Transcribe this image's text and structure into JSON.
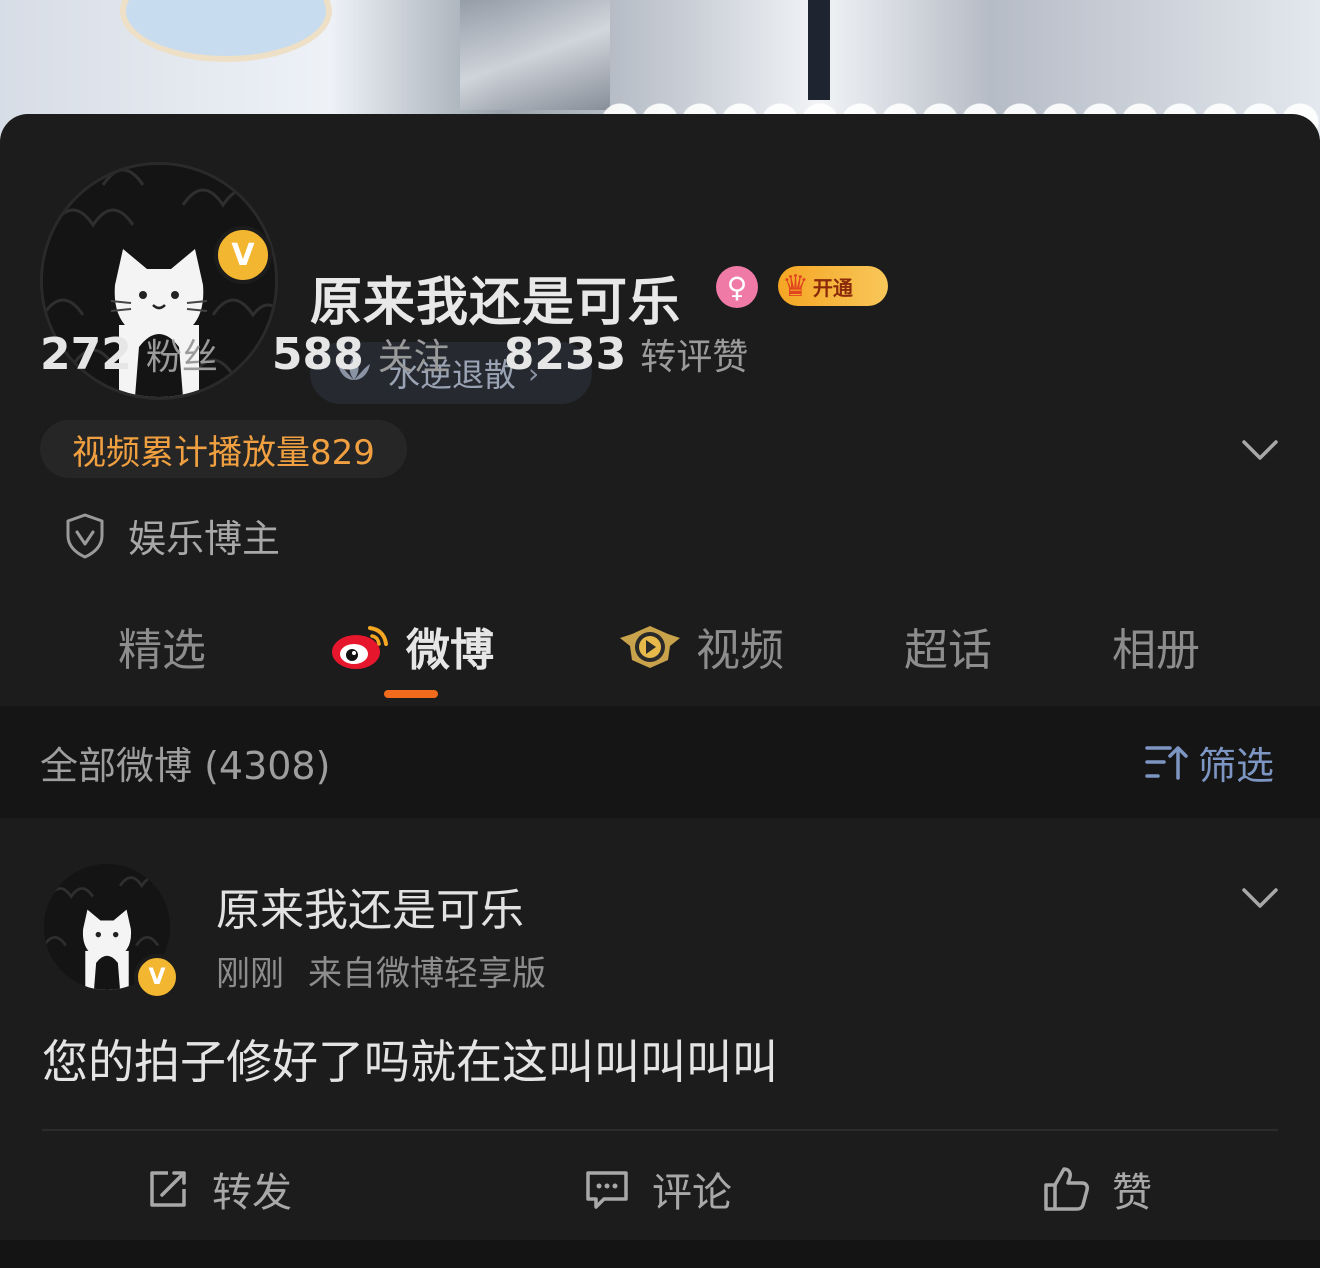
{
  "profile": {
    "username": "原来我还是可乐",
    "vip_label": "开通",
    "group_label": "水逆退散",
    "group_chevron": "›",
    "stats": [
      {
        "value": "272",
        "label": "粉丝"
      },
      {
        "value": "588",
        "label": "关注"
      },
      {
        "value": "8233",
        "label": "转评赞"
      }
    ],
    "video_plays": "视频累计播放量829",
    "tag": "娱乐博主",
    "verified_mark": "V"
  },
  "tabs": [
    {
      "label": "精选"
    },
    {
      "label": "微博"
    },
    {
      "label": "视频"
    },
    {
      "label": "超话"
    },
    {
      "label": "相册"
    }
  ],
  "filter_bar": {
    "count_label": "全部微博 (4308)",
    "filter_label": "筛选"
  },
  "post": {
    "author": "原来我还是可乐",
    "time": "刚刚",
    "source": "来自微博轻享版",
    "content": "您的拍子修好了吗就在这叫叫叫叫叫",
    "actions": {
      "repost": "转发",
      "comment": "评论",
      "like": "赞"
    }
  },
  "colors": {
    "background": "#1c1c1c",
    "accent_orange": "#f26b1d",
    "video_text": "#f0a040",
    "verified_gold": "#f2b631",
    "filter_blue": "#7d95c2"
  },
  "icons": [
    "gender-female-icon",
    "vip-crown-icon",
    "lotus-icon",
    "chevron-down-icon",
    "shield-check-icon",
    "weibo-logo-icon",
    "video-play-icon",
    "filter-icon",
    "repost-icon",
    "comment-icon",
    "like-icon"
  ]
}
